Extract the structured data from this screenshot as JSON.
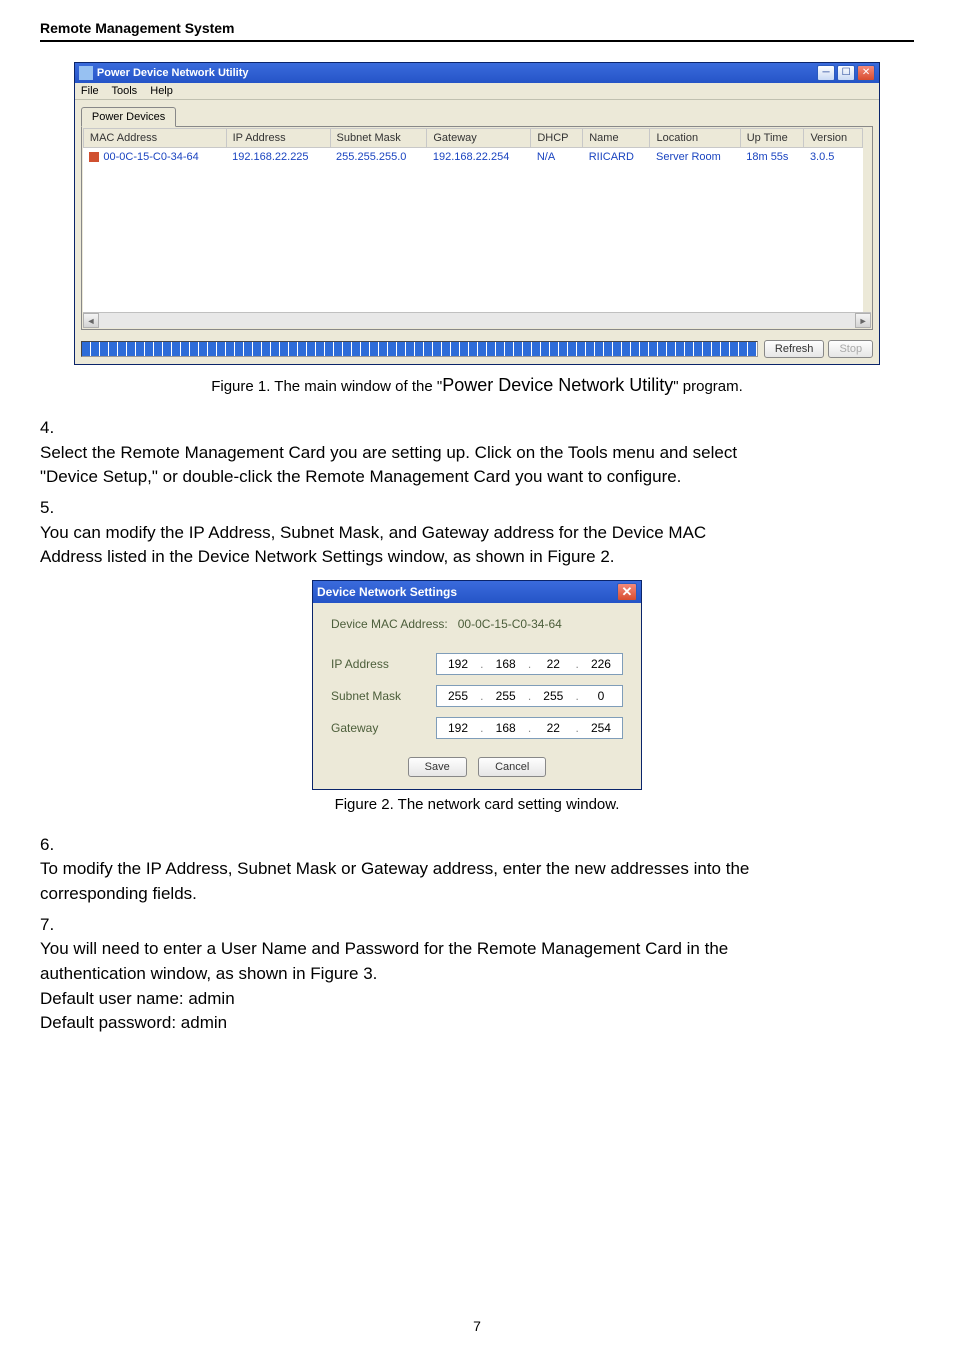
{
  "header": {
    "title": "Remote Management System"
  },
  "fig1": {
    "window_title": "Power Device Network Utility",
    "menu": [
      "File",
      "Tools",
      "Help"
    ],
    "tab": "Power Devices",
    "columns": [
      "MAC Address",
      "IP Address",
      "Subnet Mask",
      "Gateway",
      "DHCP",
      "Name",
      "Location",
      "Up Time",
      "Version"
    ],
    "row": {
      "mac": "00-0C-15-C0-34-64",
      "ip": "192.168.22.225",
      "mask": "255.255.255.0",
      "gw": "192.168.22.254",
      "dhcp": "N/A",
      "name": "RIICARD",
      "loc": "Server Room",
      "uptime": "18m 55s",
      "ver": "3.0.5"
    },
    "buttons": {
      "refresh": "Refresh",
      "stop": "Stop"
    },
    "caption_pre": "Figure 1. The main window of the \"",
    "caption_big": "Power Device Network Utility",
    "caption_post": "\" program."
  },
  "steps": {
    "s4a": "Select the Remote Management Card you are setting up. Click on the Tools menu and select",
    "s4b": "\"Device Setup,\" or double-click the Remote Management Card you want to configure.",
    "s5a": "You can modify the IP Address, Subnet Mask, and Gateway address for the Device MAC",
    "s5b": "Address listed in the Device Network Settings window, as shown in Figure 2.",
    "s6a": "To modify the IP Address, Subnet Mask or Gateway address, enter the new addresses into the",
    "s6b": "corresponding fields.",
    "s7a": "You will need to enter a User Name and Password for the Remote Management Card    in the",
    "s7b": "authentication window, as shown in Figure 3.",
    "s7c": "Default user name: admin",
    "s7d": "Default password: admin"
  },
  "fig2": {
    "title": "Device Network Settings",
    "mac_label": "Device MAC Address:",
    "mac_value": "00-0C-15-C0-34-64",
    "rows": [
      {
        "label": "IP Address",
        "oct": [
          "192",
          "168",
          "22",
          "226"
        ]
      },
      {
        "label": "Subnet Mask",
        "oct": [
          "255",
          "255",
          "255",
          "0"
        ]
      },
      {
        "label": "Gateway",
        "oct": [
          "192",
          "168",
          "22",
          "254"
        ]
      }
    ],
    "save": "Save",
    "cancel": "Cancel",
    "caption": "Figure 2. The network card setting window."
  },
  "page_number": "7"
}
